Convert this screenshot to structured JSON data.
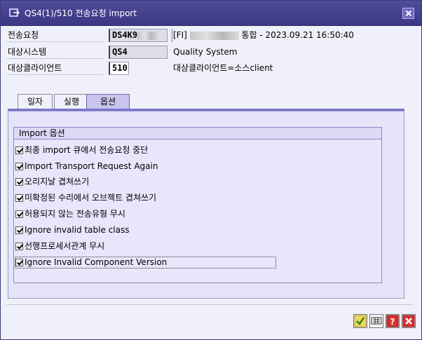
{
  "window": {
    "title": "QS4(1)/510 전송요청 import"
  },
  "fields": [
    {
      "label": "전송요청",
      "value": "DS4K9",
      "value_masked": true,
      "description": "[FI]",
      "description_suffix": "통합 - 2023.09.21  16:50:40"
    },
    {
      "label": "대상시스템",
      "value": "QS4",
      "description": "Quality System"
    },
    {
      "label": "대상클라이언트",
      "value": "510",
      "description": "대상클라이언트=소스client"
    }
  ],
  "tabs": [
    {
      "label": "일자",
      "active": false
    },
    {
      "label": "실행",
      "active": false
    },
    {
      "label": "옵션",
      "active": true
    }
  ],
  "options_group": {
    "title": "Import 옵션",
    "items": [
      {
        "label": "최종 import 큐에서 전송요청 중단",
        "checked": true
      },
      {
        "label": "Import Transport Request Again",
        "checked": true
      },
      {
        "label": "오리지날 겹쳐쓰기",
        "checked": true
      },
      {
        "label": "미확정된 수리에서 오브젝트 겹쳐쓰기",
        "checked": true
      },
      {
        "label": "허용되지 않는 전송유형 무시",
        "checked": true
      },
      {
        "label": "Ignore invalid table class",
        "checked": true
      },
      {
        "label": "선행프로세서관계 무시",
        "checked": true
      },
      {
        "label": "Ignore Invalid Component Version",
        "checked": true,
        "focused": true
      }
    ]
  },
  "toolbar": {
    "buttons": [
      {
        "icon": "checkmark-icon",
        "color": "#2a8a1a"
      },
      {
        "icon": "keyboard-icon",
        "color": "#333333"
      },
      {
        "icon": "help-icon",
        "color": "#cc2222"
      },
      {
        "icon": "cancel-icon",
        "color": "#cc2222"
      }
    ]
  },
  "colors": {
    "title_bar": "#433f8d",
    "panel": "#e6e4f8",
    "active_tab": "#c8c4ee"
  }
}
